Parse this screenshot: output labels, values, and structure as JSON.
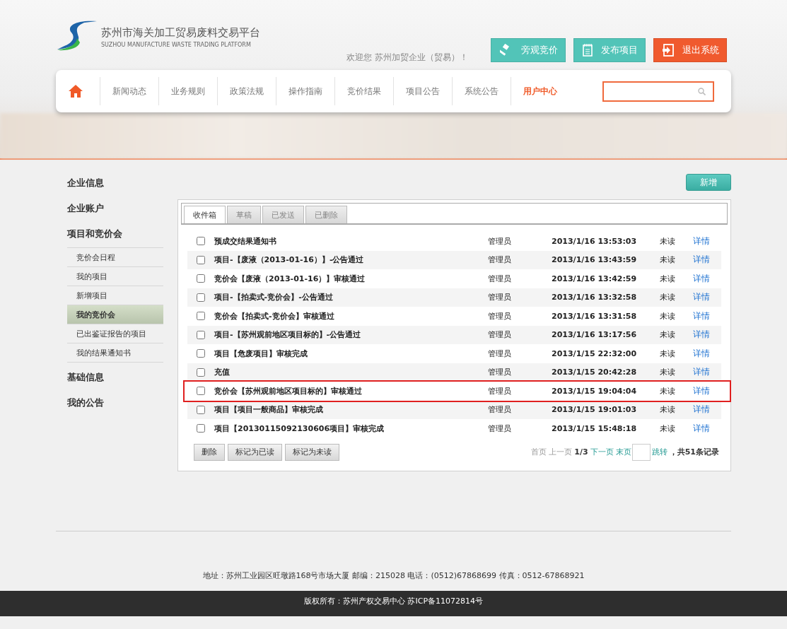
{
  "header": {
    "logo_title": "苏州市海关加工贸易废料交易平台",
    "logo_subtitle": "SUZHOU MANUFACTURE WASTE TRADING PLATFORM",
    "welcome": "欢迎您 苏州加贸企业（贸易）！",
    "action_buttons": [
      {
        "label": "旁观竞价",
        "kind": "bid"
      },
      {
        "label": "发布项目",
        "kind": "publish"
      },
      {
        "label": "退出系统",
        "kind": "logout"
      }
    ]
  },
  "nav": {
    "items": [
      {
        "label": "新闻动态",
        "selected": false
      },
      {
        "label": "业务规则",
        "selected": false
      },
      {
        "label": "政策法规",
        "selected": false
      },
      {
        "label": "操作指南",
        "selected": false
      },
      {
        "label": "竞价结果",
        "selected": false
      },
      {
        "label": "项目公告",
        "selected": false
      },
      {
        "label": "系统公告",
        "selected": false
      },
      {
        "label": "用户中心",
        "selected": true
      }
    ]
  },
  "sidebar": {
    "sections": [
      {
        "label": "企业信息"
      },
      {
        "label": "企业账户"
      },
      {
        "label": "项目和竞价会",
        "children": [
          {
            "label": "竞价会日程",
            "selected": false
          },
          {
            "label": "我的项目",
            "selected": false
          },
          {
            "label": "新增项目",
            "selected": false
          },
          {
            "label": "我的竞价会",
            "selected": true
          },
          {
            "label": "已出鉴证报告的项目",
            "selected": false
          },
          {
            "label": "我的结果通知书",
            "selected": false
          }
        ]
      },
      {
        "label": "基础信息"
      },
      {
        "label": "我的公告"
      }
    ]
  },
  "new_button": "新增",
  "tabs": [
    {
      "label": "收件箱",
      "selected": true
    },
    {
      "label": "草稿",
      "selected": false
    },
    {
      "label": "已发送",
      "selected": false
    },
    {
      "label": "已删除",
      "selected": false
    }
  ],
  "messages": [
    {
      "title": "预成交结果通知书",
      "sender": "管理员",
      "time": "2013/1/16 13:53:03",
      "status": "未读",
      "action": "详情",
      "checked": false,
      "highlighted": false
    },
    {
      "title": "项目-【废液（2013-01-16）】-公告通过",
      "sender": "管理员",
      "time": "2013/1/16 13:43:59",
      "status": "未读",
      "action": "详情",
      "checked": false,
      "highlighted": false
    },
    {
      "title": "竞价会【废液（2013-01-16）】审核通过",
      "sender": "管理员",
      "time": "2013/1/16 13:42:59",
      "status": "未读",
      "action": "详情",
      "checked": false,
      "highlighted": false
    },
    {
      "title": "项目-【拍卖式-竞价会】-公告通过",
      "sender": "管理员",
      "time": "2013/1/16 13:32:58",
      "status": "未读",
      "action": "详情",
      "checked": false,
      "highlighted": false
    },
    {
      "title": "竞价会【拍卖式-竞价会】审核通过",
      "sender": "管理员",
      "time": "2013/1/16 13:31:58",
      "status": "未读",
      "action": "详情",
      "checked": false,
      "highlighted": false
    },
    {
      "title": "项目-【苏州观前地区项目标的】-公告通过",
      "sender": "管理员",
      "time": "2013/1/16 13:17:56",
      "status": "未读",
      "action": "详情",
      "checked": false,
      "highlighted": false
    },
    {
      "title": "项目【危废项目】审核完成",
      "sender": "管理员",
      "time": "2013/1/15 22:32:00",
      "status": "未读",
      "action": "详情",
      "checked": false,
      "highlighted": false
    },
    {
      "title": "充值",
      "sender": "管理员",
      "time": "2013/1/15 20:42:28",
      "status": "未读",
      "action": "详情",
      "checked": false,
      "highlighted": false
    },
    {
      "title": "竞价会【苏州观前地区项目标的】审核通过",
      "sender": "管理员",
      "time": "2013/1/15 19:04:04",
      "status": "未读",
      "action": "详情",
      "checked": false,
      "highlighted": true
    },
    {
      "title": "项目【项目一般商品】审核完成",
      "sender": "管理员",
      "time": "2013/1/15 19:01:03",
      "status": "未读",
      "action": "详情",
      "checked": false,
      "highlighted": false
    },
    {
      "title": "项目【20130115092130606项目】审核完成",
      "sender": "管理员",
      "time": "2013/1/15 15:48:18",
      "status": "未读",
      "action": "详情",
      "checked": false,
      "highlighted": false
    }
  ],
  "bulk_buttons": [
    "删除",
    "标记为已读",
    "标记为未读"
  ],
  "pagination": {
    "links": [
      {
        "label": "首页",
        "disabled": true
      },
      {
        "label": "上一页",
        "disabled": true
      }
    ],
    "current": "1/3",
    "next_links": [
      {
        "label": "下一页",
        "disabled": false
      },
      {
        "label": "末页",
        "disabled": false
      }
    ],
    "jump": "跳转",
    "total": "，共51条记录"
  },
  "footer": {
    "address": "地址：苏州工业园区旺墩路168号市场大厦 邮编：215028 电话：(0512)67868699 传真：0512-67868921",
    "copyright": "版权所有：苏州产权交易中心  苏ICP备11072814号"
  }
}
